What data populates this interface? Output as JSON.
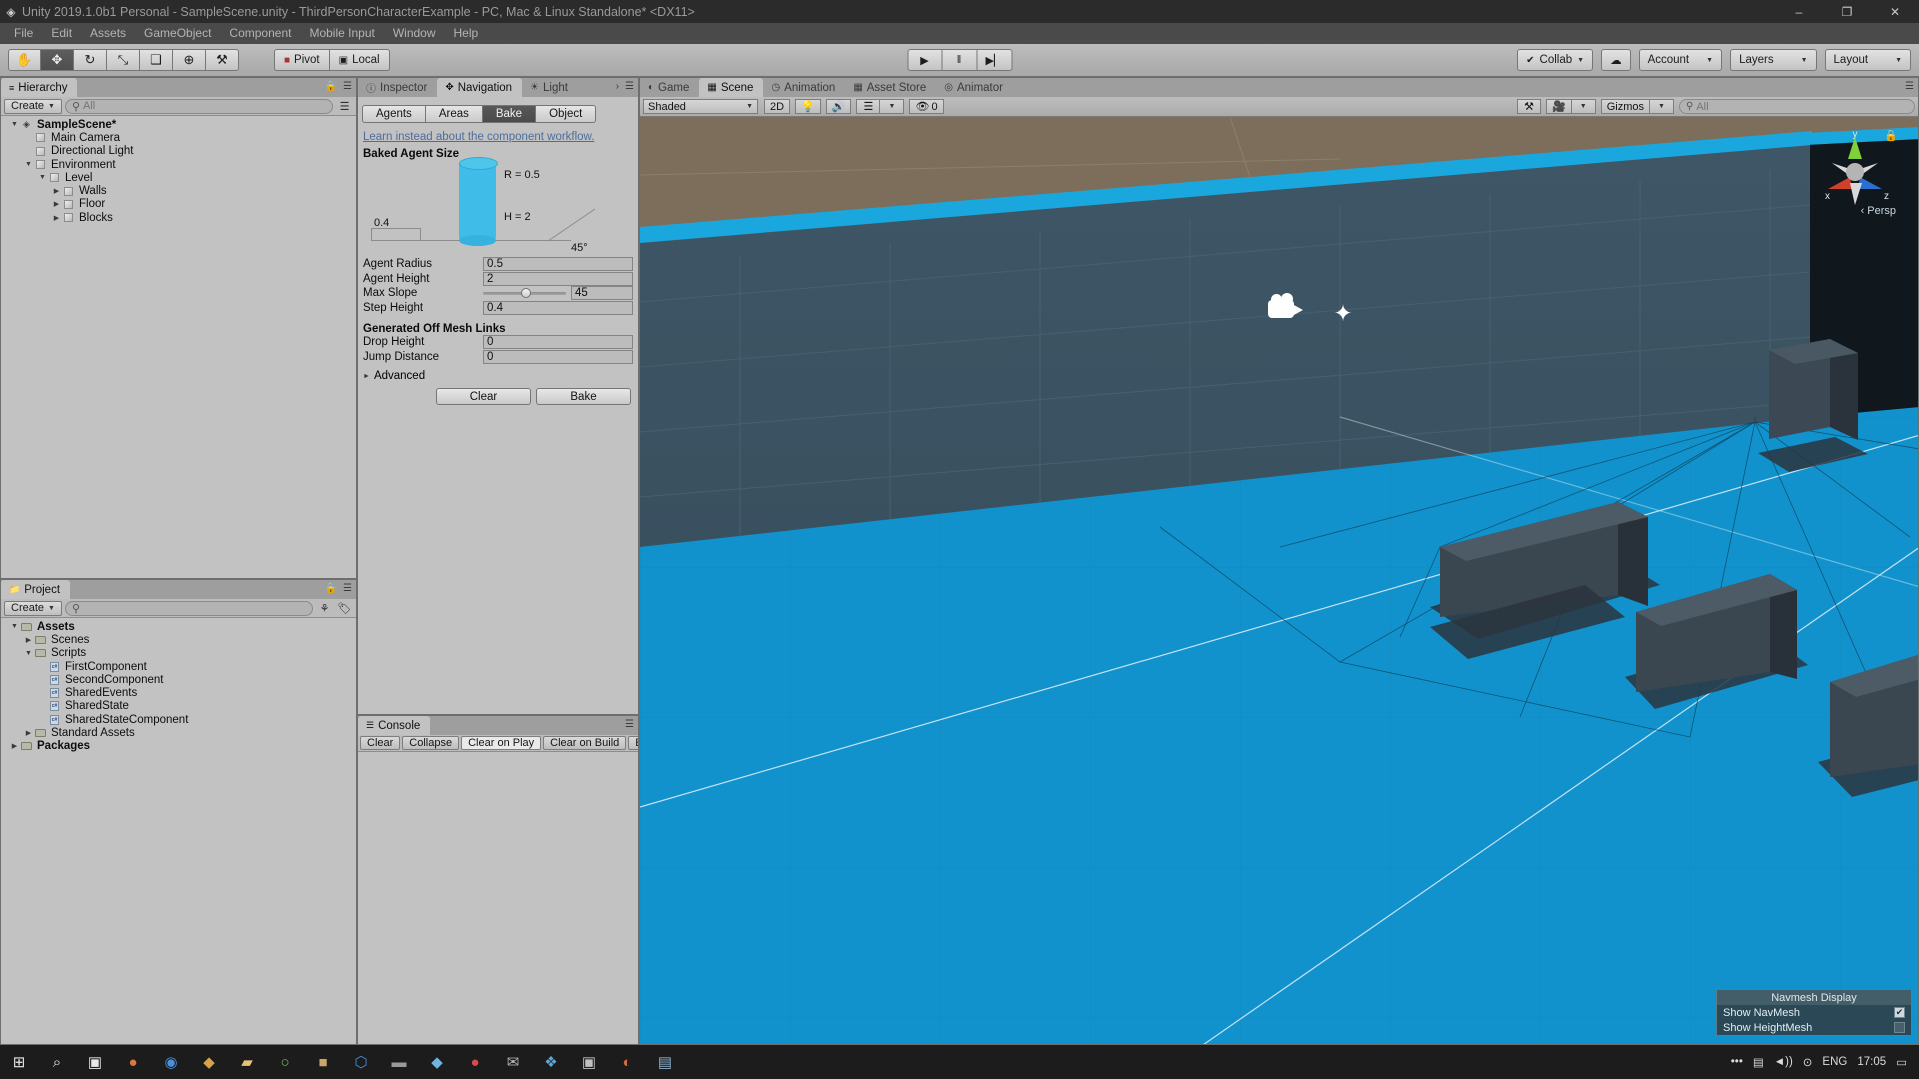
{
  "window": {
    "title": "Unity 2019.1.0b1 Personal - SampleScene.unity - ThirdPersonCharacterExample - PC, Mac & Linux Standalone* <DX11>",
    "minimize": "–",
    "maximize": "❐",
    "close": "✕"
  },
  "menu": [
    "File",
    "Edit",
    "Assets",
    "GameObject",
    "Component",
    "Mobile Input",
    "Window",
    "Help"
  ],
  "toolbar": {
    "tools": [
      {
        "name": "hand-tool",
        "glyph": "✋",
        "active": false
      },
      {
        "name": "move-tool",
        "glyph": "✥",
        "active": true
      },
      {
        "name": "rotate-tool",
        "glyph": "↻",
        "active": false
      },
      {
        "name": "scale-tool",
        "glyph": "⤡",
        "active": false
      },
      {
        "name": "rect-tool",
        "glyph": "❑",
        "active": false
      },
      {
        "name": "transform-tool",
        "glyph": "⊕",
        "active": false
      },
      {
        "name": "custom-tool",
        "glyph": "⚒",
        "active": false
      }
    ],
    "pivot_label": "Pivot",
    "local_label": "Local",
    "play_label": "▶",
    "pause_label": "‖",
    "step_label": "▶▏",
    "collab_label": "Collab",
    "cloud_label": "☁",
    "account_label": "Account",
    "layers_label": "Layers",
    "layout_label": "Layout"
  },
  "hierarchy": {
    "tab": "Hierarchy",
    "create_label": "Create",
    "search_placeholder": "All",
    "search_value": "",
    "items": [
      {
        "label": "SampleScene*",
        "depth": 0,
        "arrow": "down",
        "icon": "scene-icon",
        "bold": true
      },
      {
        "label": "Main Camera",
        "depth": 1,
        "arrow": "none",
        "icon": "gameobject-icon",
        "bold": false
      },
      {
        "label": "Directional Light",
        "depth": 1,
        "arrow": "none",
        "icon": "gameobject-icon",
        "bold": false
      },
      {
        "label": "Environment",
        "depth": 1,
        "arrow": "down",
        "icon": "gameobject-icon",
        "bold": false
      },
      {
        "label": "Level",
        "depth": 2,
        "arrow": "down",
        "icon": "gameobject-icon",
        "bold": false
      },
      {
        "label": "Walls",
        "depth": 3,
        "arrow": "right",
        "icon": "gameobject-icon",
        "bold": false
      },
      {
        "label": "Floor",
        "depth": 3,
        "arrow": "right",
        "icon": "gameobject-icon",
        "bold": false
      },
      {
        "label": "Blocks",
        "depth": 3,
        "arrow": "right",
        "icon": "gameobject-icon",
        "bold": false
      }
    ]
  },
  "project": {
    "tab": "Project",
    "create_label": "Create",
    "search_placeholder": "",
    "search_value": "",
    "items": [
      {
        "label": "Assets",
        "depth": 0,
        "arrow": "down",
        "icon": "folder-icon",
        "bold": true
      },
      {
        "label": "Scenes",
        "depth": 1,
        "arrow": "right",
        "icon": "folder-icon",
        "bold": false
      },
      {
        "label": "Scripts",
        "depth": 1,
        "arrow": "down",
        "icon": "folder-icon",
        "bold": false
      },
      {
        "label": "FirstComponent",
        "depth": 2,
        "arrow": "none",
        "icon": "csharp-icon",
        "bold": false
      },
      {
        "label": "SecondComponent",
        "depth": 2,
        "arrow": "none",
        "icon": "csharp-icon",
        "bold": false
      },
      {
        "label": "SharedEvents",
        "depth": 2,
        "arrow": "none",
        "icon": "csharp-icon",
        "bold": false
      },
      {
        "label": "SharedState",
        "depth": 2,
        "arrow": "none",
        "icon": "csharp-icon",
        "bold": false
      },
      {
        "label": "SharedStateComponent",
        "depth": 2,
        "arrow": "none",
        "icon": "csharp-icon",
        "bold": false
      },
      {
        "label": "Standard Assets",
        "depth": 1,
        "arrow": "right",
        "icon": "folder-icon",
        "bold": false
      },
      {
        "label": "Packages",
        "depth": 0,
        "arrow": "right",
        "icon": "folder-icon",
        "bold": true
      }
    ]
  },
  "inspector": {
    "tabs": [
      {
        "label": "Inspector",
        "icon": "info-icon",
        "active": false
      },
      {
        "label": "Navigation",
        "icon": "navigation-icon",
        "active": true
      },
      {
        "label": "Light",
        "icon": "light-icon",
        "active": false
      }
    ],
    "nav_tabs": [
      {
        "label": "Agents",
        "active": false
      },
      {
        "label": "Areas",
        "active": false
      },
      {
        "label": "Bake",
        "active": true
      },
      {
        "label": "Object",
        "active": false
      }
    ],
    "learn_link": "Learn instead about the component workflow.",
    "baked_agent_size_header": "Baked Agent Size",
    "viz": {
      "radius_label": "R = 0.5",
      "height_label": "H = 2",
      "step_label": "0.4",
      "slope_label": "45°"
    },
    "fields": [
      {
        "label": "Agent Radius",
        "value": "0.5",
        "type": "text"
      },
      {
        "label": "Agent Height",
        "value": "2",
        "type": "text"
      },
      {
        "label": "Max Slope",
        "value": "45",
        "type": "slider"
      },
      {
        "label": "Step Height",
        "value": "0.4",
        "type": "text"
      }
    ],
    "offmesh_header": "Generated Off Mesh Links",
    "offmesh_fields": [
      {
        "label": "Drop Height",
        "value": "0"
      },
      {
        "label": "Jump Distance",
        "value": "0"
      }
    ],
    "advanced_label": "Advanced",
    "clear_label": "Clear",
    "bake_label": "Bake"
  },
  "console": {
    "tab": "Console",
    "buttons": [
      "Clear",
      "Collapse",
      "Clear on Play",
      "Clear on Build",
      "Er"
    ]
  },
  "scene": {
    "tabs": [
      {
        "label": "Game",
        "icon": "game-icon",
        "active": false
      },
      {
        "label": "Scene",
        "icon": "scene-grid-icon",
        "active": true
      },
      {
        "label": "Animation",
        "icon": "clock-icon",
        "active": false
      },
      {
        "label": "Asset Store",
        "icon": "store-icon",
        "active": false
      },
      {
        "label": "Animator",
        "icon": "animator-icon",
        "active": false
      }
    ],
    "shading_mode": "Shaded",
    "mode_2d": "2D",
    "light_icon": "lightbulb-icon",
    "audio_icon": "speaker-icon",
    "fx_icon": "effects-icon",
    "hidden_count": "0",
    "tools_icon": "tools-icon",
    "camera_icon": "camera-icon",
    "gizmos_label": "Gizmos",
    "search_placeholder": "All",
    "search_value": "",
    "persp_label": "Persp",
    "gizmo_axes": {
      "x": "x",
      "y": "y",
      "z": "z"
    },
    "navmesh_display": {
      "title": "Navmesh Display",
      "options": [
        {
          "label": "Show NavMesh",
          "checked": true
        },
        {
          "label": "Show HeightMesh",
          "checked": false
        }
      ]
    }
  },
  "taskbar": {
    "items": [
      {
        "name": "start-button",
        "glyph": "⊞",
        "color": "#e8e8e8"
      },
      {
        "name": "search-icon",
        "glyph": "⌕",
        "color": "#e8e8e8"
      },
      {
        "name": "taskview-icon",
        "glyph": "▣",
        "color": "#e8e8e8"
      },
      {
        "name": "firefox-icon",
        "glyph": "●",
        "color": "#e0763a"
      },
      {
        "name": "chrome-icon",
        "glyph": "◉",
        "color": "#4a90d9"
      },
      {
        "name": "unity-icon",
        "glyph": "◆",
        "color": "#d6a24a"
      },
      {
        "name": "folder-icon",
        "glyph": "▰",
        "color": "#e8c372"
      },
      {
        "name": "browser-icon",
        "glyph": "○",
        "color": "#7fbf4f"
      },
      {
        "name": "app1-icon",
        "glyph": "■",
        "color": "#c8a56a"
      },
      {
        "name": "vscode-icon",
        "glyph": "⬡",
        "color": "#4a90d9"
      },
      {
        "name": "app2-icon",
        "glyph": "▬",
        "color": "#9a9a9a"
      },
      {
        "name": "app3-icon",
        "glyph": "◆",
        "color": "#6fb5e0"
      },
      {
        "name": "app4-icon",
        "glyph": "●",
        "color": "#d94a4a"
      },
      {
        "name": "mail-icon",
        "glyph": "✉",
        "color": "#b8b8b8"
      },
      {
        "name": "app5-icon",
        "glyph": "❖",
        "color": "#5fa8d3"
      },
      {
        "name": "app6-icon",
        "glyph": "▣",
        "color": "#c0c0c0"
      },
      {
        "name": "app7-icon",
        "glyph": "◐",
        "color": "#d96a3a"
      },
      {
        "name": "app8-icon",
        "glyph": "▤",
        "color": "#8fb3cf"
      }
    ],
    "tray": {
      "overflow": "•••",
      "network": "▤",
      "volume": "◄))",
      "settings": "⊙",
      "language": "ENG",
      "time": "17:05",
      "notifications": "▭"
    }
  }
}
